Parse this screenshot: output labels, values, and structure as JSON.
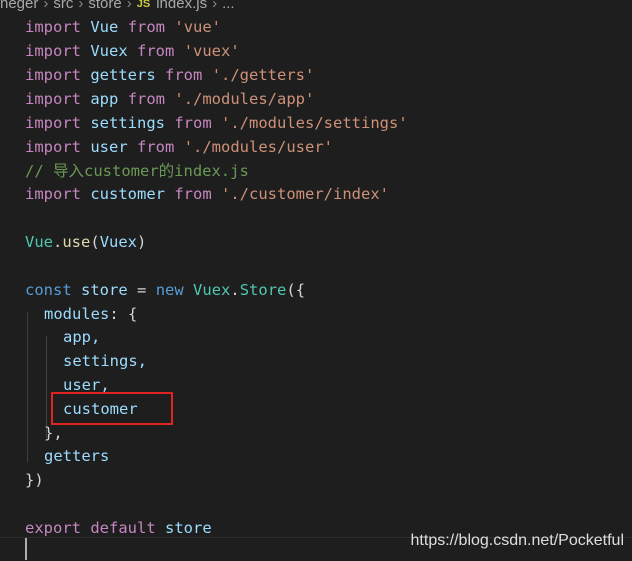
{
  "breadcrumb": {
    "items": [
      "neger",
      "src",
      "store"
    ],
    "js_badge": "JS",
    "file": "index.js",
    "ellipsis": "..."
  },
  "code": {
    "import_kw": "import",
    "from_kw": "from",
    "line1": {
      "name": "Vue",
      "path": "'vue'"
    },
    "line2": {
      "name": "Vuex",
      "path": "'vuex'"
    },
    "line3": {
      "name": "getters",
      "path": "'./getters'"
    },
    "line4": {
      "name": "app",
      "path": "'./modules/app'"
    },
    "line5": {
      "name": "settings",
      "path": "'./modules/settings'"
    },
    "line6": {
      "name": "user",
      "path": "'./modules/user'"
    },
    "comment": "// 导入customer的index.js",
    "line8": {
      "name": "customer",
      "path": "'./customer/index'"
    },
    "use_line": {
      "obj": "Vue",
      "dot": ".",
      "method": "use",
      "open": "(",
      "arg": "Vuex",
      "close": ")"
    },
    "store_line": {
      "const": "const",
      "name": "store",
      "eq": " = ",
      "new": "new",
      "cls1": "Vuex",
      "dot": ".",
      "cls2": "Store",
      "open": "({"
    },
    "modules_line": {
      "key": "modules",
      "rest": ": {"
    },
    "mod_items": [
      "app,",
      "settings,",
      "user,",
      "customer"
    ],
    "close_modules": "},",
    "getters_line": "getters",
    "close_store": "})",
    "export_line": {
      "export": "export",
      "default": "default",
      "name": "store"
    }
  },
  "watermark": "https://blog.csdn.net/Pocketful",
  "colors": {
    "background": "#1e1e1e",
    "keyword_import": "#c586c0",
    "keyword_blue": "#569cd6",
    "identifier": "#9cdcfe",
    "string": "#ce9178",
    "comment": "#6a9955",
    "class": "#4ec9b0",
    "function": "#dcdcaa",
    "highlight_box": "#e02424"
  }
}
